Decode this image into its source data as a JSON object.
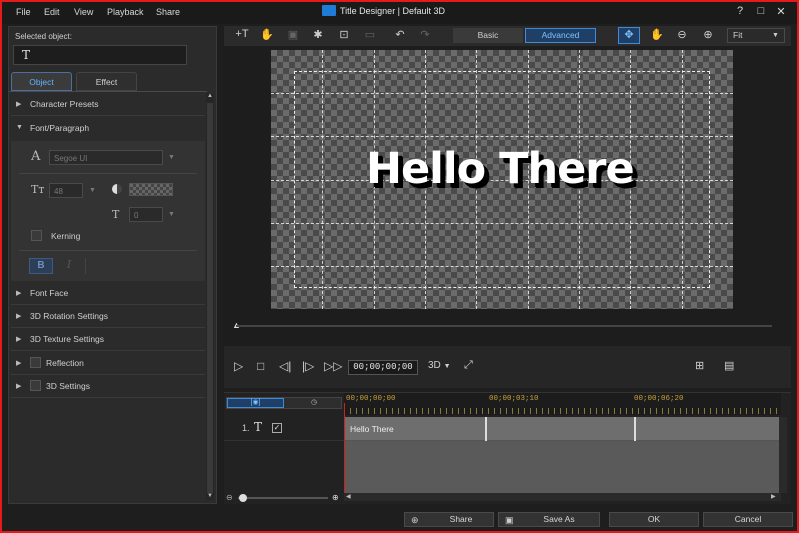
{
  "menu": [
    "File",
    "Edit",
    "View",
    "Playback",
    "Share"
  ],
  "app_title": "Title Designer | Default 3D",
  "window_buttons": {
    "help": "?",
    "minimize": "□",
    "close": "✕"
  },
  "selected_object": {
    "label": "Selected object:",
    "icon": "T"
  },
  "tabs": {
    "object": "Object",
    "effect": "Effect"
  },
  "sections": {
    "character_presets": "Character Presets",
    "font_paragraph": "Font/Paragraph",
    "font_face": "Font Face",
    "rotation": "3D Rotation Settings",
    "texture": "3D Texture Settings",
    "reflection": "Reflection",
    "settings_3d": "3D Settings"
  },
  "font": {
    "family": "Segoe UI",
    "size": "48",
    "spacing": "0",
    "kerning": "Kerning",
    "bold": "B",
    "italic": "I",
    "font_icon": "A",
    "size_icon": "Tт",
    "spacing_icon": "T"
  },
  "toolbar": {
    "basic": "Basic",
    "advanced": "Advanced",
    "fit": "Fit"
  },
  "canvas": {
    "title_text": "Hello There"
  },
  "transport": {
    "timecode": "00;00;00;00",
    "mode": "3D"
  },
  "timeline": {
    "ticks": [
      "00;00;00;00",
      "00;00;03;10",
      "00;00;06;20"
    ],
    "track_number": "1.",
    "track_icon": "T",
    "clip_label": "Hello There"
  },
  "buttons": {
    "share": "Share",
    "save_as": "Save As",
    "ok": "OK",
    "cancel": "Cancel"
  },
  "colors": {
    "accent": "#3f8bd6",
    "frame": "#e41b1b"
  }
}
